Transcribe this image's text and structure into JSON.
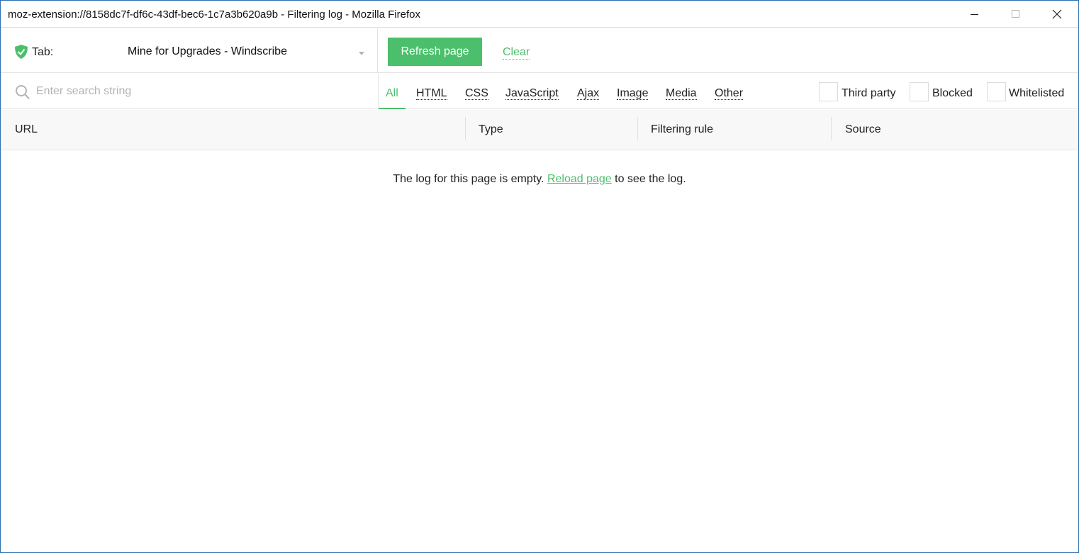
{
  "window": {
    "title": "moz-extension://8158dc7f-df6c-43df-bec6-1c7a3b620a9b - Filtering log - Mozilla Firefox"
  },
  "toolbar": {
    "tab_label": "Tab:",
    "tab_selected": "Mine for Upgrades - Windscribe",
    "refresh_label": "Refresh page",
    "clear_label": "Clear"
  },
  "search": {
    "placeholder": "Enter search string"
  },
  "type_tabs": [
    "All",
    "HTML",
    "CSS",
    "JavaScript",
    "Ajax",
    "Image",
    "Media",
    "Other"
  ],
  "filters": [
    "Third party",
    "Blocked",
    "Whitelisted"
  ],
  "columns": [
    "URL",
    "Type",
    "Filtering rule",
    "Source"
  ],
  "empty": {
    "before": "The log for this page is empty.",
    "link": "Reload page",
    "after": "to see the log."
  },
  "colors": {
    "accent": "#4bbf6b"
  },
  "icons": [
    "shield-check-icon",
    "search-icon",
    "chevron-down-icon",
    "minimize-icon",
    "maximize-icon",
    "close-icon"
  ]
}
